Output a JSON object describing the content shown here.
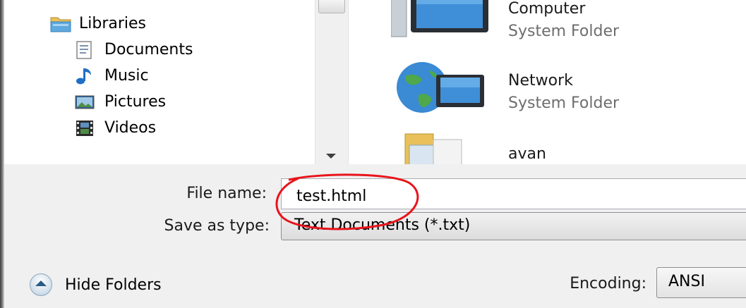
{
  "nav": {
    "items": [
      {
        "label": "Libraries",
        "icon": "libraries-folder-icon"
      },
      {
        "label": "Documents",
        "icon": "documents-icon"
      },
      {
        "label": "Music",
        "icon": "music-note-icon"
      },
      {
        "label": "Pictures",
        "icon": "pictures-icon"
      },
      {
        "label": "Videos",
        "icon": "film-strip-icon"
      }
    ]
  },
  "content": {
    "items": [
      {
        "name": "Computer",
        "type": "System Folder",
        "icon": "computer-monitor-icon"
      },
      {
        "name": "Network",
        "type": "System Folder",
        "icon": "network-globe-icon"
      },
      {
        "name": "avan",
        "type": "",
        "icon": "user-folder-icon"
      }
    ]
  },
  "form": {
    "filename_label": "File name:",
    "filename_value": "test.html",
    "savetype_label": "Save as type:",
    "savetype_value": "Text Documents (*.txt)",
    "encoding_label": "Encoding:",
    "encoding_value": "ANSI",
    "hide_folders_label": "Hide Folders"
  },
  "colors": {
    "annotation_circle": "#e8141b",
    "form_background": "#f0f0f0"
  }
}
